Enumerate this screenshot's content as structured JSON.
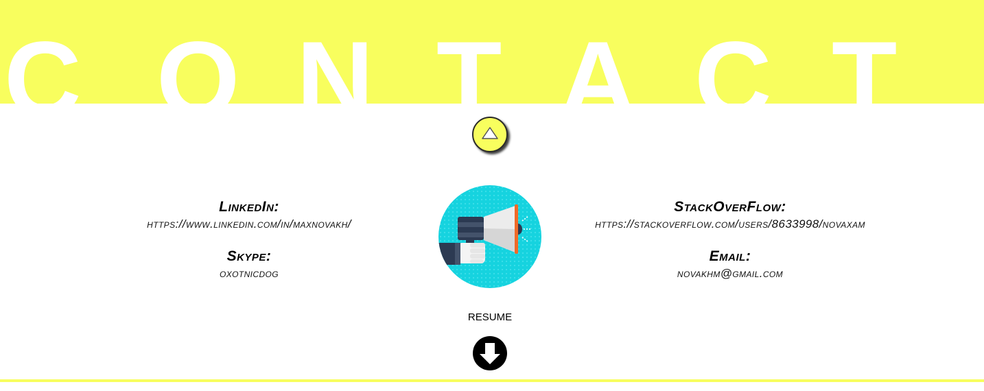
{
  "banner": {
    "letters": [
      "C",
      "O",
      "N",
      "T",
      "A",
      "C",
      "T"
    ]
  },
  "colors": {
    "banner_yellow": "#f8fe5e",
    "megaphone_cyan": "#16d3df",
    "text": "#000000"
  },
  "nav": {
    "up_icon": "triangle-up-icon",
    "down_icon": "arrow-down-circle-icon"
  },
  "contacts": {
    "linkedin": {
      "label": "LinkedIn:",
      "value": "https://www.linkedin.com/in/maxnovakh/"
    },
    "skype": {
      "label": "Skype:",
      "value": "oxotnicdog"
    },
    "stackoverflow": {
      "label": "StackOverFlow:",
      "value": "https://stackoverflow.com/users/8633998/novaxam"
    },
    "email": {
      "label": "Email:",
      "value": "novakhm@gmail.com"
    }
  },
  "illustration": {
    "icon": "megaphone-icon"
  },
  "resume": {
    "label": "RESUME"
  }
}
